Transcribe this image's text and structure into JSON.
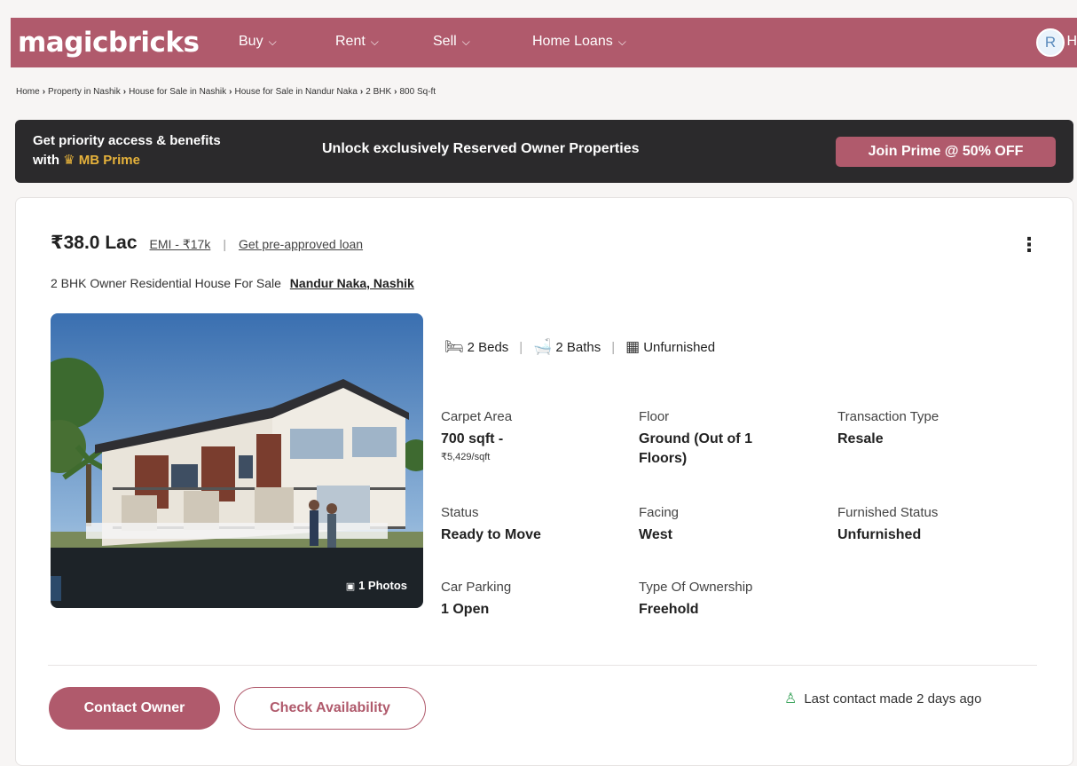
{
  "nav": {
    "logo": "magicbricks",
    "items": [
      {
        "label": "Buy"
      },
      {
        "label": "Rent"
      },
      {
        "label": "Sell"
      },
      {
        "label": "Home Loans"
      }
    ],
    "avatar_initial": "R",
    "edge_text": "H",
    "brand_color": "#b05a6c"
  },
  "breadcrumb": [
    "Home",
    "Property in Nashik",
    "House for Sale in Nashik",
    "House for Sale in Nandur Naka",
    "2 BHK",
    "800 Sq-ft"
  ],
  "prime": {
    "line1": "Get priority access & benefits",
    "line2_prefix": "with",
    "line2_brand": "MB Prime",
    "headline": "Unlock exclusively Reserved Owner Properties",
    "cta": "Join Prime @ 50% OFF"
  },
  "listing": {
    "price": "₹38.0 Lac",
    "emi": "EMI - ₹17k",
    "loan_link": "Get pre-approved loan",
    "title": "2 BHK Owner Residential House For Sale",
    "location": "Nandur Naka, Nashik",
    "photo_count": "1 Photos",
    "amenities": {
      "beds": "2 Beds",
      "baths": "2 Baths",
      "furnishing": "Unfurnished"
    },
    "details": {
      "carpet_area": {
        "label": "Carpet Area",
        "value": "700 sqft -",
        "sub": "₹5,429/sqft"
      },
      "floor": {
        "label": "Floor",
        "value": "Ground (Out of 1 Floors)"
      },
      "transaction_type": {
        "label": "Transaction Type",
        "value": "Resale"
      },
      "status": {
        "label": "Status",
        "value": "Ready to Move"
      },
      "facing": {
        "label": "Facing",
        "value": "West"
      },
      "furnished_status": {
        "label": "Furnished Status",
        "value": "Unfurnished"
      },
      "car_parking": {
        "label": "Car Parking",
        "value": "1 Open"
      },
      "ownership": {
        "label": "Type Of Ownership",
        "value": "Freehold"
      }
    },
    "contact_button": "Contact Owner",
    "check_button": "Check Availability",
    "last_contact": "Last contact made 2 days ago"
  }
}
